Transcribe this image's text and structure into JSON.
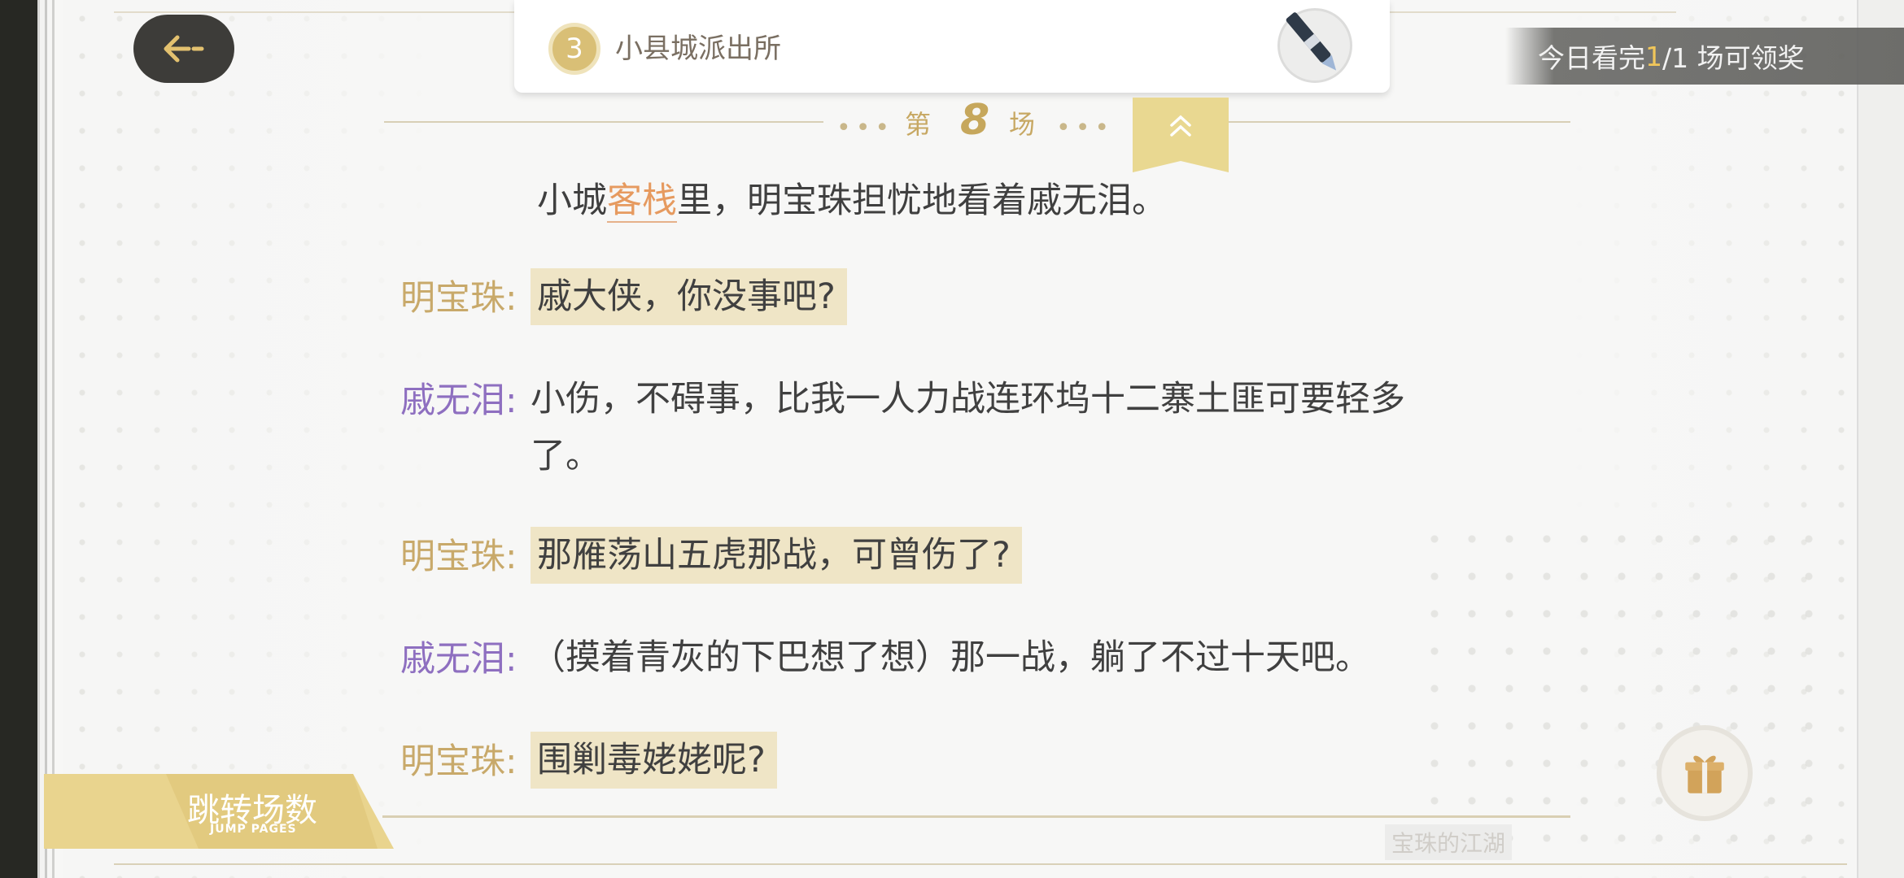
{
  "chapter": {
    "number": "3",
    "title": "小县城派出所"
  },
  "reward_banner": {
    "prefix": "今日看完 ",
    "count": "1",
    "suffix": "/1 场可领奖"
  },
  "scene": {
    "label_before": "第",
    "number": "8",
    "label_after": "场"
  },
  "narration": {
    "before": "小城",
    "keyword": "客栈",
    "after": "里，明宝珠担忧地看着戚无泪。"
  },
  "dialogue": [
    {
      "speaker": "明宝珠:",
      "line": "戚大侠，你没事吧?"
    },
    {
      "speaker": "戚无泪:",
      "line1": "小伤，不碍事，比我一人力战连环坞十二寨土匪可要轻多",
      "line2": "了。"
    },
    {
      "speaker": "明宝珠:",
      "line": "那雁荡山五虎那战，可曾伤了?"
    },
    {
      "speaker": "戚无泪:",
      "line": "（摸着青灰的下巴想了想）那一战，躺了不过十天吧。"
    },
    {
      "speaker": "明宝珠:",
      "line": "围剿毒姥姥呢?"
    }
  ],
  "jump_pages": {
    "cn": "跳转场数",
    "en": "JUMP PAGES"
  },
  "book_name": "宝珠的江湖",
  "colors": {
    "gold_speaker": "#c8a96a",
    "purple_speaker": "#8e6fc0",
    "highlight": "#efe5c6",
    "keyword": "#e69a5f"
  },
  "icons": {
    "back": "back-arrow-icon",
    "pen": "pen-icon",
    "collapse": "chevron-up-double-icon",
    "gift": "gift-icon"
  }
}
